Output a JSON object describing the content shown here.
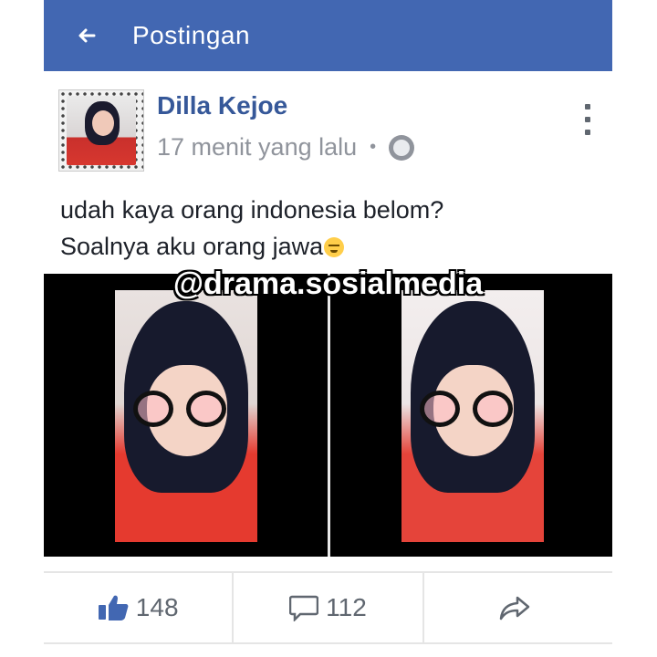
{
  "header": {
    "back_icon": "arrow-left-icon",
    "title": "Postingan"
  },
  "post": {
    "author": "Dilla Kejoe",
    "time": "17 menit yang lalu",
    "separator": "•",
    "privacy_icon": "globe-icon",
    "text_line1": "udah kaya orang indonesia belom?",
    "text_line2": "Soalnya aku orang jawa",
    "watermark": "@drama.sosialmedia"
  },
  "actions": {
    "like_icon": "thumbs-up-icon",
    "like_count": "148",
    "comment_icon": "comment-icon",
    "comment_count": "112",
    "share_icon": "share-icon"
  },
  "colors": {
    "header_bg": "#4267b2",
    "author_color": "#365899",
    "like_icon_color": "#4267b2"
  }
}
